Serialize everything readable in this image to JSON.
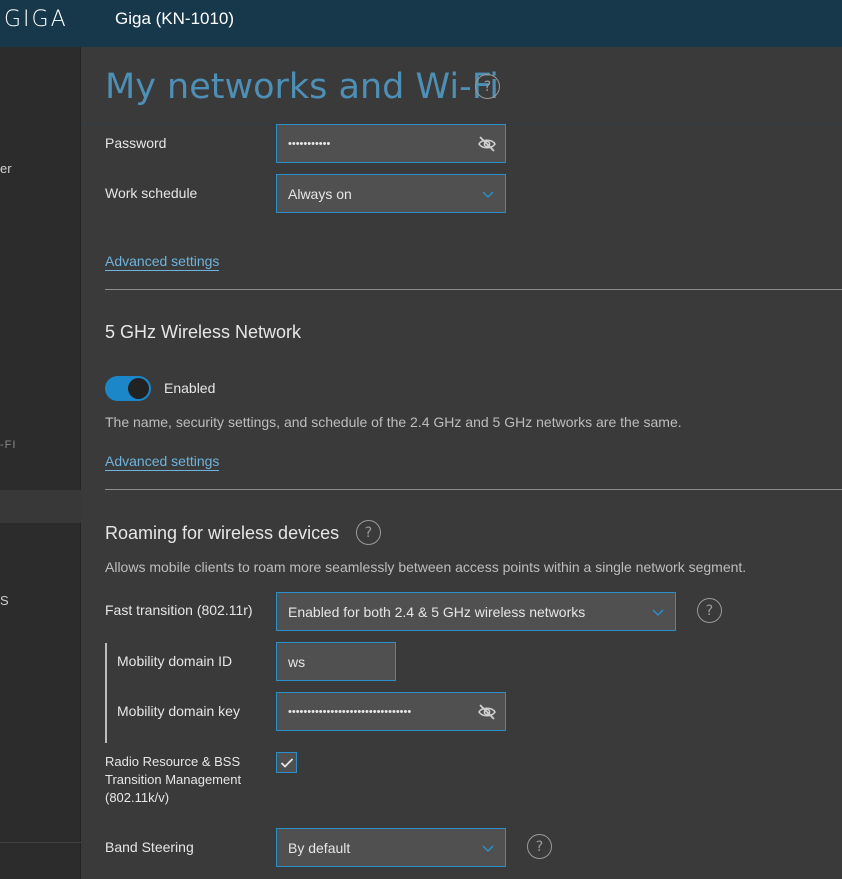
{
  "header": {
    "logo": "GIGA",
    "device": "Giga (KN-1010)"
  },
  "sidebar": {
    "fragments": [
      "er",
      "-FI",
      "S"
    ]
  },
  "page": {
    "title": "My networks and Wi-Fi",
    "help": "?"
  },
  "wifi24": {
    "password_label": "Password",
    "password_value": "•••••••••••",
    "schedule_label": "Work schedule",
    "schedule_value": "Always on",
    "advanced_link": "Advanced settings"
  },
  "wifi5": {
    "title": "5 GHz Wireless Network",
    "toggle_label": "Enabled",
    "toggle_state": true,
    "note": "The name, security settings, and schedule of the 2.4 GHz and 5 GHz networks are the same.",
    "advanced_link": "Advanced settings"
  },
  "roaming": {
    "title": "Roaming for wireless devices",
    "description": "Allows mobile clients to roam more seamlessly between access points within a single network segment.",
    "fast_transition_label": "Fast transition (802.11r)",
    "fast_transition_value": "Enabled for both 2.4 & 5 GHz wireless networks",
    "mobility_id_label": "Mobility domain ID",
    "mobility_id_value": "ws",
    "mobility_key_label": "Mobility domain key",
    "mobility_key_value": "••••••••••••••••••••••••••••••••",
    "rrm_label_line1": "Radio Resource & BSS",
    "rrm_label_line2": "Transition Management",
    "rrm_label_line3": "(802.11k/v)",
    "rrm_checked": true,
    "band_steering_label": "Band Steering",
    "band_steering_value": "By default"
  },
  "colors": {
    "accent": "#2b90c9",
    "title": "#4e8fb5",
    "link": "#6fb3dc",
    "topbar": "#17384b"
  },
  "icons": {
    "password_toggle": "eye-off-icon",
    "dropdown": "chevron-down-icon",
    "help": "help-circle-icon",
    "check": "checkmark-icon"
  }
}
